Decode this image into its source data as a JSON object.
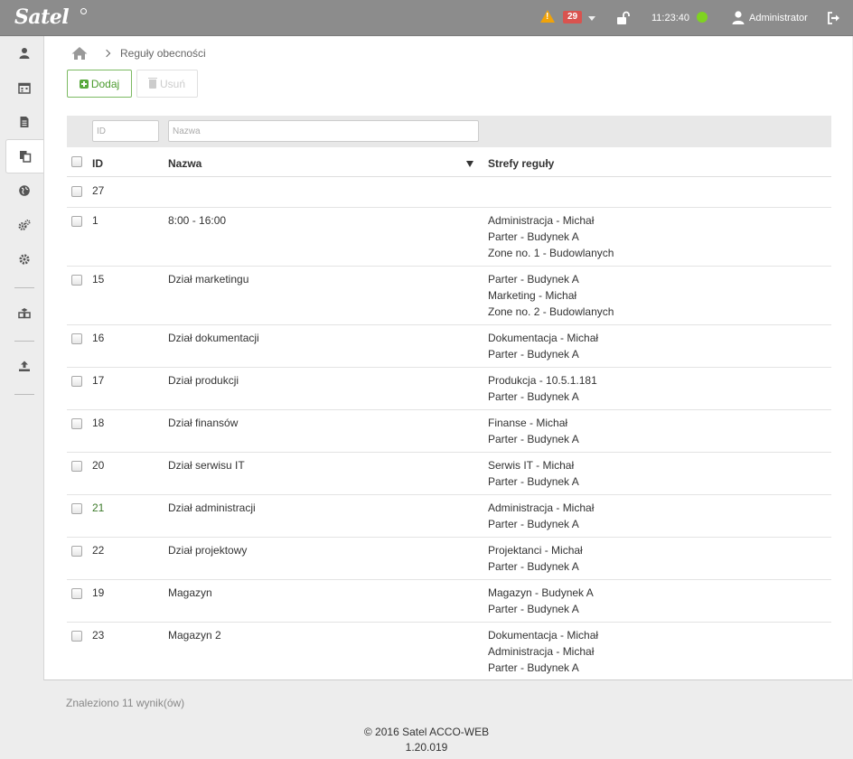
{
  "app": {
    "logo": "Satel",
    "alerts_count": "29",
    "clock": "11:23:40",
    "user": "Administrator"
  },
  "breadcrumb": {
    "current": "Reguły obecności"
  },
  "toolbar": {
    "add_label": "Dodaj",
    "delete_label": "Usuń"
  },
  "filters": {
    "id_placeholder": "ID",
    "name_placeholder": "Nazwa"
  },
  "table": {
    "headers": {
      "id": "ID",
      "name": "Nazwa",
      "zones": "Strefy reguły"
    },
    "rows": [
      {
        "id": "27",
        "name": "",
        "zones": []
      },
      {
        "id": "1",
        "name": "8:00 - 16:00",
        "zones": [
          "Administracja - Michał",
          "Parter - Budynek A",
          "Zone no. 1 - Budowlanych"
        ]
      },
      {
        "id": "15",
        "name": "Dział marketingu",
        "zones": [
          "Parter - Budynek A",
          "Marketing - Michał",
          "Zone no. 2 - Budowlanych"
        ]
      },
      {
        "id": "16",
        "name": "Dział dokumentacji",
        "zones": [
          "Dokumentacja - Michał",
          "Parter - Budynek A"
        ]
      },
      {
        "id": "17",
        "name": "Dział produkcji",
        "zones": [
          "Produkcja - 10.5.1.181",
          "Parter - Budynek A"
        ]
      },
      {
        "id": "18",
        "name": "Dział finansów",
        "zones": [
          "Finanse - Michał",
          "Parter - Budynek A"
        ]
      },
      {
        "id": "20",
        "name": "Dział serwisu IT",
        "zones": [
          "Serwis IT - Michał",
          "Parter - Budynek A"
        ]
      },
      {
        "id": "21",
        "name": "Dział administracji",
        "zones": [
          "Administracja - Michał",
          "Parter - Budynek A"
        ]
      },
      {
        "id": "22",
        "name": "Dział projektowy",
        "zones": [
          "Projektanci - Michał",
          "Parter - Budynek A"
        ]
      },
      {
        "id": "19",
        "name": "Magazyn",
        "zones": [
          "Magazyn - Budynek A",
          "Parter - Budynek A"
        ]
      },
      {
        "id": "23",
        "name": "Magazyn 2",
        "zones": [
          "Dokumentacja - Michał",
          "Administracja - Michał",
          "Parter - Budynek A"
        ]
      }
    ]
  },
  "results_text": "Znaleziono 11 wynik(ów)",
  "footer": {
    "copyright_prefix": "© 2016 Satel",
    "product": "ACCO-WEB",
    "version": "1.20.019"
  },
  "colors": {
    "topbar": "#8c8c8c",
    "accent_green": "#59a93d",
    "badge_red": "#d9534f",
    "warning": "#f0a30a",
    "status_online": "#7fd320"
  },
  "icons": [
    "user-icon",
    "calendar-icon",
    "document-icon",
    "copy-icon",
    "globe-icon",
    "cogs-icon",
    "gear-icon",
    "cubes-icon",
    "upload-icon"
  ]
}
